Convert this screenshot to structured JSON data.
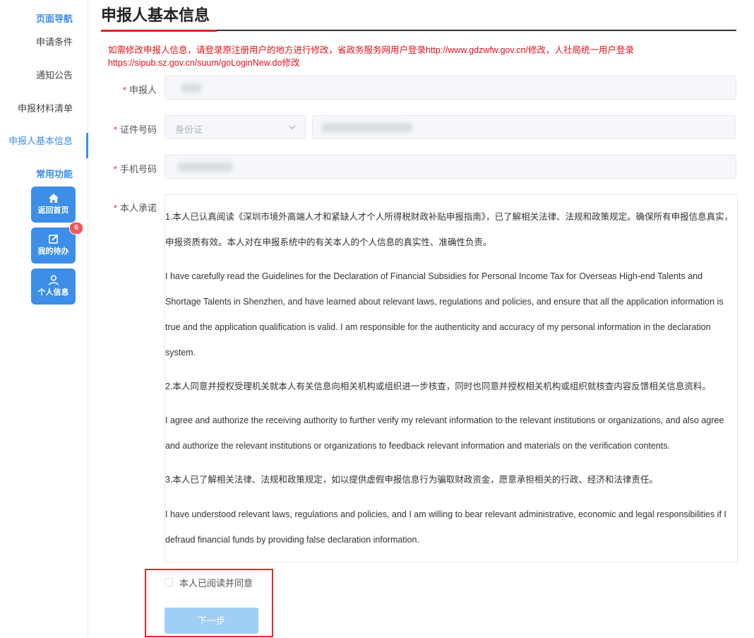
{
  "sidebar": {
    "nav_heading": "页面导航",
    "nav_items": [
      {
        "label": "申请条件"
      },
      {
        "label": "通知公告"
      },
      {
        "label": "申报材料清单"
      },
      {
        "label": "申报人基本信息",
        "active": true
      }
    ],
    "func_heading": "常用功能",
    "func_buttons": [
      {
        "label": "返回首页",
        "icon": "home-icon"
      },
      {
        "label": "我的待办",
        "icon": "edit-icon",
        "badge": "6"
      },
      {
        "label": "个人信息",
        "icon": "user-icon"
      }
    ]
  },
  "main": {
    "title": "申报人基本信息",
    "notice": "如需修改申报人信息，请登录原注册用户的地方进行修改，省政务服务网用户登录http://www.gdzwfw.gov.cn/修改，人社局统一用户登录https://sipub.sz.gov.cn/suum/goLoginNew.do修改",
    "form": {
      "applicant_label": "申报人",
      "id_label": "证件号码",
      "id_type": "身份证",
      "phone_label": "手机号码",
      "pledge_label": "本人承诺",
      "pledge_paragraphs": [
        "1.本人已认真阅读《深圳市境外高端人才和紧缺人才个人所得税财政补贴申报指南》，已了解相关法律、法规和政策规定。确保所有申报信息真实，申报资质有效。本人对在申报系统中的有关本人的个人信息的真实性、准确性负责。",
        "I have carefully read the Guidelines for the Declaration of Financial Subsidies for Personal Income Tax for Overseas High-end Talents and Shortage Talents in Shenzhen, and have learned about relevant laws, regulations and policies, and ensure that all the application information is true and the application qualification is valid. I am responsible for the authenticity and accuracy of my personal information in the declaration system.",
        "2.本人同意并授权受理机关就本人有关信息向相关机构或组织进一步核查，同时也同意并授权相关机构或组织就核查内容反馈相关信息资料。",
        "I agree and authorize the receiving authority to further verify my relevant information to the relevant institutions or organizations, and also agree and authorize the relevant institutions or organizations to feedback relevant information and materials on the verification contents.",
        "3.本人已了解相关法律、法规和政策规定，如以提供虚假申报信息行为骗取财政资金，愿意承担相关的行政、经济和法律责任。",
        "I have understood relevant laws, regulations and policies, and I am willing to bear relevant administrative, economic and legal responsibilities if I defraud financial funds by providing false declaration information."
      ],
      "agree_label": "本人已阅读并同意",
      "next_label": "下一步"
    }
  },
  "colors": {
    "accent": "#3c8ee8",
    "notice": "#e0121a",
    "highlight_box": "#e0282a",
    "button_disabled": "#a0cff5"
  }
}
